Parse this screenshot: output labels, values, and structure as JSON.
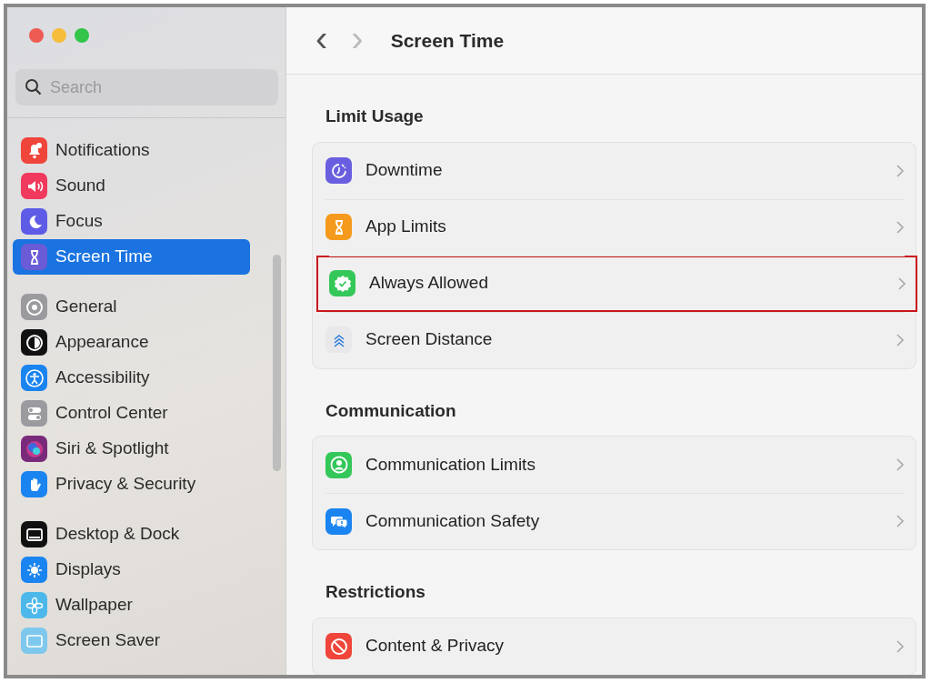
{
  "window": {
    "title": "Screen Time",
    "back": "‹",
    "forward": "›"
  },
  "search": {
    "placeholder": "Search"
  },
  "sidebar": {
    "groups": [
      {
        "items": [
          {
            "label": "Notifications",
            "color": "#f0453a",
            "selected": false
          },
          {
            "label": "Sound",
            "color": "#f0395c",
            "selected": false
          },
          {
            "label": "Focus",
            "color": "#5e5ce6",
            "selected": false
          },
          {
            "label": "Screen Time",
            "color": "#6a5bd6",
            "selected": true
          }
        ]
      },
      {
        "items": [
          {
            "label": "General",
            "color": "#9a9a9f",
            "selected": false
          },
          {
            "label": "Appearance",
            "color": "#111111",
            "selected": false
          },
          {
            "label": "Accessibility",
            "color": "#1a84f0",
            "selected": false
          },
          {
            "label": "Control Center",
            "color": "#9a9a9f",
            "selected": false
          },
          {
            "label": "Siri & Spotlight",
            "color": "#7a2a7a",
            "selected": false
          },
          {
            "label": "Privacy & Security",
            "color": "#1a84f0",
            "selected": false
          }
        ]
      },
      {
        "items": [
          {
            "label": "Desktop & Dock",
            "color": "#111111",
            "selected": false
          },
          {
            "label": "Displays",
            "color": "#1a84f0",
            "selected": false
          },
          {
            "label": "Wallpaper",
            "color": "#4cb8ea",
            "selected": false
          },
          {
            "label": "Screen Saver",
            "color": "#7ec8ee",
            "selected": false
          }
        ]
      }
    ]
  },
  "sections": [
    {
      "title": "Limit Usage",
      "rows": [
        {
          "label": "Downtime",
          "color": "#6a5ee0",
          "highlighted": false
        },
        {
          "label": "App Limits",
          "color": "#f59a1c",
          "highlighted": false
        },
        {
          "label": "Always Allowed",
          "color": "#34c759",
          "highlighted": true
        },
        {
          "label": "Screen Distance",
          "color": "#e8e8ea",
          "highlighted": false
        }
      ]
    },
    {
      "title": "Communication",
      "rows": [
        {
          "label": "Communication Limits",
          "color": "#34c759",
          "highlighted": false
        },
        {
          "label": "Communication Safety",
          "color": "#1a84f0",
          "highlighted": false
        }
      ]
    },
    {
      "title": "Restrictions",
      "rows": [
        {
          "label": "Content & Privacy",
          "color": "#f0453a",
          "highlighted": false
        }
      ]
    }
  ]
}
